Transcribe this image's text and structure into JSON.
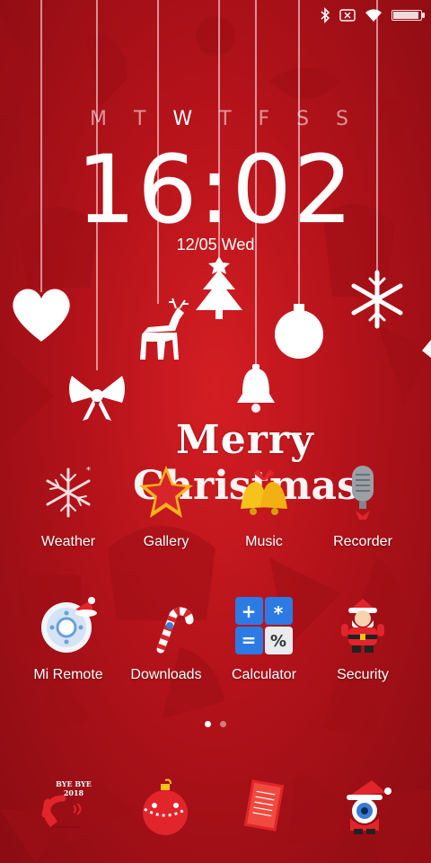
{
  "status_bar": {
    "icons": [
      "bluetooth-icon",
      "no-sim-icon",
      "wifi-icon",
      "battery-icon"
    ],
    "battery_level": 0.95
  },
  "weekdays": [
    "M",
    "T",
    "W",
    "T",
    "F",
    "S",
    "S"
  ],
  "active_day_index": 2,
  "clock": {
    "hours": "16",
    "minutes": "02"
  },
  "date": "12/05  Wed",
  "greeting": {
    "line1": "Merry",
    "line2": "Christmas"
  },
  "apps_row1": [
    {
      "label": "Weather",
      "icon": "snowflake-icon"
    },
    {
      "label": "Gallery",
      "icon": "star-icon"
    },
    {
      "label": "Music",
      "icon": "bells-icon"
    },
    {
      "label": "Recorder",
      "icon": "microphone-icon"
    }
  ],
  "apps_row2": [
    {
      "label": "Mi Remote",
      "icon": "remote-icon"
    },
    {
      "label": "Downloads",
      "icon": "candy-cane-icon"
    },
    {
      "label": "Calculator",
      "icon": "calculator-icon"
    },
    {
      "label": "Security",
      "icon": "santa-icon"
    }
  ],
  "calculator_symbols": [
    "+",
    "*",
    "=",
    "%"
  ],
  "page_indicator": {
    "pages": 2,
    "active": 0
  },
  "dock": [
    {
      "icon": "phone-icon",
      "badge_line1": "BYE BYE",
      "badge_line2": "2018"
    },
    {
      "icon": "ornament-ball-icon"
    },
    {
      "icon": "notes-icon"
    },
    {
      "icon": "camera-santa-icon"
    }
  ],
  "colors": {
    "background": "#c4161c",
    "accent_white": "#ffffff",
    "dark_red": "#8a0c12"
  }
}
